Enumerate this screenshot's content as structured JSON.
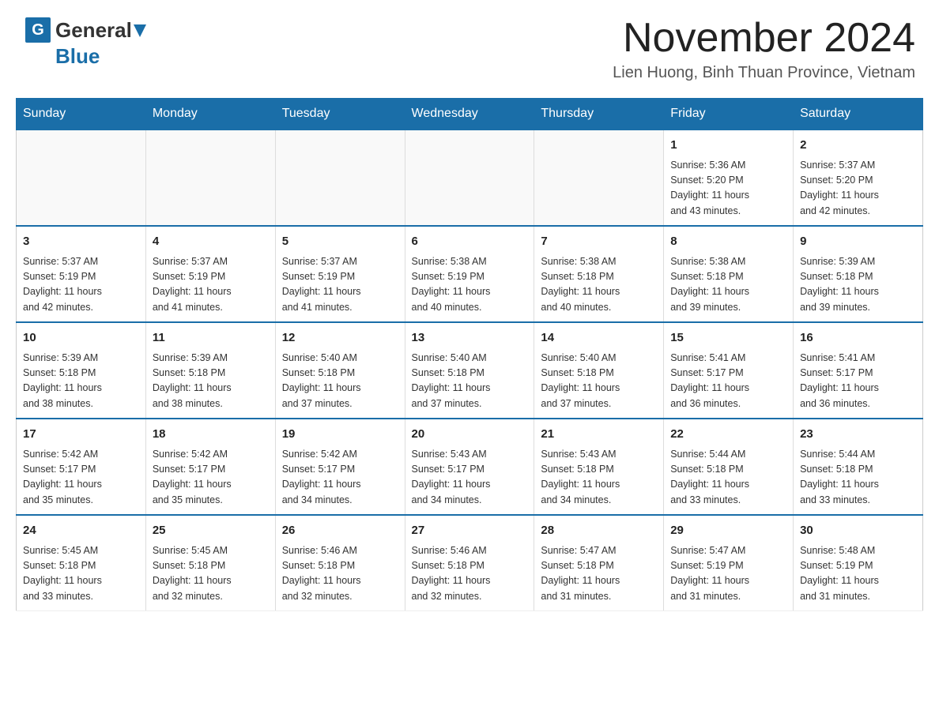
{
  "header": {
    "logo_general": "General",
    "logo_blue": "Blue",
    "title": "November 2024",
    "subtitle": "Lien Huong, Binh Thuan Province, Vietnam"
  },
  "calendar": {
    "days_of_week": [
      "Sunday",
      "Monday",
      "Tuesday",
      "Wednesday",
      "Thursday",
      "Friday",
      "Saturday"
    ],
    "weeks": [
      [
        {
          "day": "",
          "info": ""
        },
        {
          "day": "",
          "info": ""
        },
        {
          "day": "",
          "info": ""
        },
        {
          "day": "",
          "info": ""
        },
        {
          "day": "",
          "info": ""
        },
        {
          "day": "1",
          "info": "Sunrise: 5:36 AM\nSunset: 5:20 PM\nDaylight: 11 hours\nand 43 minutes."
        },
        {
          "day": "2",
          "info": "Sunrise: 5:37 AM\nSunset: 5:20 PM\nDaylight: 11 hours\nand 42 minutes."
        }
      ],
      [
        {
          "day": "3",
          "info": "Sunrise: 5:37 AM\nSunset: 5:19 PM\nDaylight: 11 hours\nand 42 minutes."
        },
        {
          "day": "4",
          "info": "Sunrise: 5:37 AM\nSunset: 5:19 PM\nDaylight: 11 hours\nand 41 minutes."
        },
        {
          "day": "5",
          "info": "Sunrise: 5:37 AM\nSunset: 5:19 PM\nDaylight: 11 hours\nand 41 minutes."
        },
        {
          "day": "6",
          "info": "Sunrise: 5:38 AM\nSunset: 5:19 PM\nDaylight: 11 hours\nand 40 minutes."
        },
        {
          "day": "7",
          "info": "Sunrise: 5:38 AM\nSunset: 5:18 PM\nDaylight: 11 hours\nand 40 minutes."
        },
        {
          "day": "8",
          "info": "Sunrise: 5:38 AM\nSunset: 5:18 PM\nDaylight: 11 hours\nand 39 minutes."
        },
        {
          "day": "9",
          "info": "Sunrise: 5:39 AM\nSunset: 5:18 PM\nDaylight: 11 hours\nand 39 minutes."
        }
      ],
      [
        {
          "day": "10",
          "info": "Sunrise: 5:39 AM\nSunset: 5:18 PM\nDaylight: 11 hours\nand 38 minutes."
        },
        {
          "day": "11",
          "info": "Sunrise: 5:39 AM\nSunset: 5:18 PM\nDaylight: 11 hours\nand 38 minutes."
        },
        {
          "day": "12",
          "info": "Sunrise: 5:40 AM\nSunset: 5:18 PM\nDaylight: 11 hours\nand 37 minutes."
        },
        {
          "day": "13",
          "info": "Sunrise: 5:40 AM\nSunset: 5:18 PM\nDaylight: 11 hours\nand 37 minutes."
        },
        {
          "day": "14",
          "info": "Sunrise: 5:40 AM\nSunset: 5:18 PM\nDaylight: 11 hours\nand 37 minutes."
        },
        {
          "day": "15",
          "info": "Sunrise: 5:41 AM\nSunset: 5:17 PM\nDaylight: 11 hours\nand 36 minutes."
        },
        {
          "day": "16",
          "info": "Sunrise: 5:41 AM\nSunset: 5:17 PM\nDaylight: 11 hours\nand 36 minutes."
        }
      ],
      [
        {
          "day": "17",
          "info": "Sunrise: 5:42 AM\nSunset: 5:17 PM\nDaylight: 11 hours\nand 35 minutes."
        },
        {
          "day": "18",
          "info": "Sunrise: 5:42 AM\nSunset: 5:17 PM\nDaylight: 11 hours\nand 35 minutes."
        },
        {
          "day": "19",
          "info": "Sunrise: 5:42 AM\nSunset: 5:17 PM\nDaylight: 11 hours\nand 34 minutes."
        },
        {
          "day": "20",
          "info": "Sunrise: 5:43 AM\nSunset: 5:17 PM\nDaylight: 11 hours\nand 34 minutes."
        },
        {
          "day": "21",
          "info": "Sunrise: 5:43 AM\nSunset: 5:18 PM\nDaylight: 11 hours\nand 34 minutes."
        },
        {
          "day": "22",
          "info": "Sunrise: 5:44 AM\nSunset: 5:18 PM\nDaylight: 11 hours\nand 33 minutes."
        },
        {
          "day": "23",
          "info": "Sunrise: 5:44 AM\nSunset: 5:18 PM\nDaylight: 11 hours\nand 33 minutes."
        }
      ],
      [
        {
          "day": "24",
          "info": "Sunrise: 5:45 AM\nSunset: 5:18 PM\nDaylight: 11 hours\nand 33 minutes."
        },
        {
          "day": "25",
          "info": "Sunrise: 5:45 AM\nSunset: 5:18 PM\nDaylight: 11 hours\nand 32 minutes."
        },
        {
          "day": "26",
          "info": "Sunrise: 5:46 AM\nSunset: 5:18 PM\nDaylight: 11 hours\nand 32 minutes."
        },
        {
          "day": "27",
          "info": "Sunrise: 5:46 AM\nSunset: 5:18 PM\nDaylight: 11 hours\nand 32 minutes."
        },
        {
          "day": "28",
          "info": "Sunrise: 5:47 AM\nSunset: 5:18 PM\nDaylight: 11 hours\nand 31 minutes."
        },
        {
          "day": "29",
          "info": "Sunrise: 5:47 AM\nSunset: 5:19 PM\nDaylight: 11 hours\nand 31 minutes."
        },
        {
          "day": "30",
          "info": "Sunrise: 5:48 AM\nSunset: 5:19 PM\nDaylight: 11 hours\nand 31 minutes."
        }
      ]
    ]
  }
}
